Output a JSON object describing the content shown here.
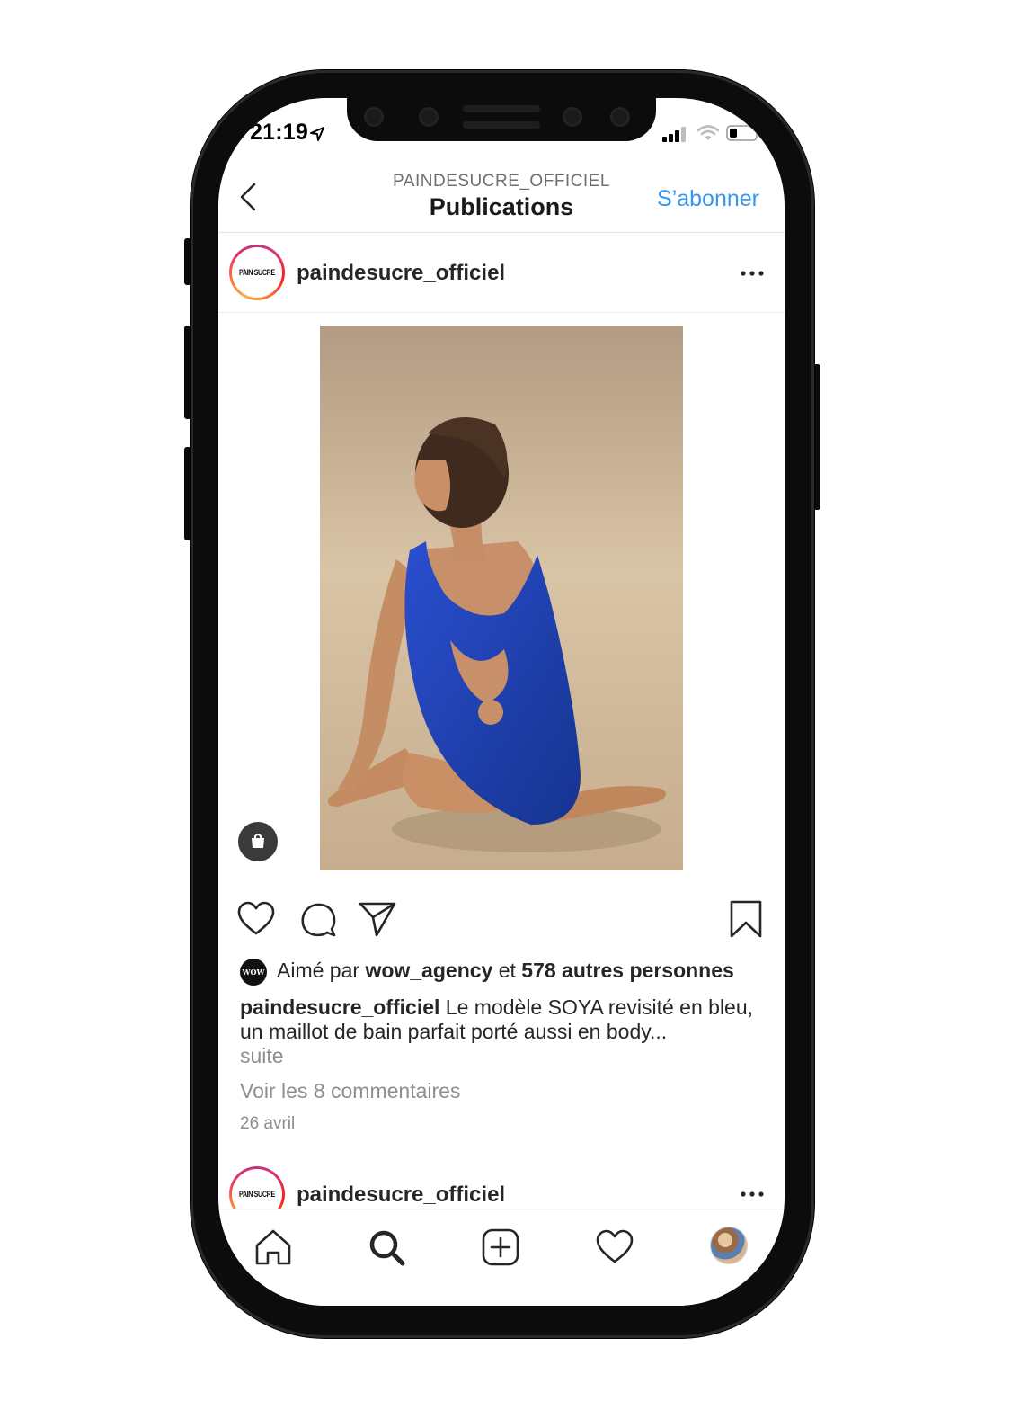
{
  "status_bar": {
    "time": "21:19"
  },
  "nav": {
    "account": "PAINDESUCRE_OFFICIEL",
    "title": "Publications",
    "follow_label": "S’abonner"
  },
  "posts": [
    {
      "username": "paindesucre_officiel",
      "avatar_logo": "PAIN SUCRE",
      "photo_alt": "Model in blue swimsuit sitting on sand",
      "likes": {
        "prefix": "Aimé par ",
        "user": "wow_agency",
        "conj": " et ",
        "others": "578 autres personnes",
        "avatar_text": "WOW"
      },
      "caption": {
        "user": "paindesucre_officiel",
        "text": " Le modèle SOYA revisité en bleu, un maillot de bain parfait porté aussi en body...",
        "more": "suite"
      },
      "comments_link": "Voir les 8 commentaires",
      "date": "26 avril"
    },
    {
      "username": "paindesucre_officiel",
      "avatar_logo": "PAIN SUCRE"
    }
  ],
  "colors": {
    "accent": "#3897f0",
    "text": "#262626",
    "muted": "#8e8e8e",
    "swimsuit": "#1f3fae",
    "sand": "#c9b294"
  },
  "tabbar": {
    "items": [
      "home-icon",
      "search-icon",
      "new-post-icon",
      "activity-heart-icon",
      "profile-avatar"
    ]
  }
}
